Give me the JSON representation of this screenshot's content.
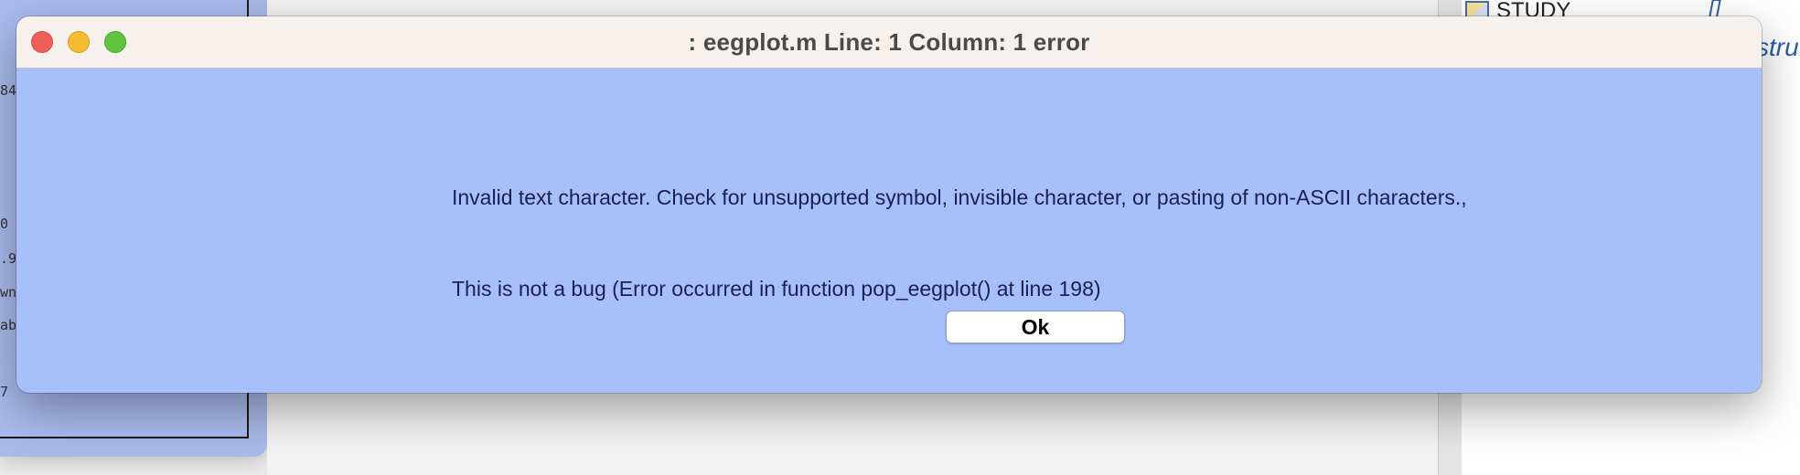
{
  "background": {
    "left_window": {
      "text_lines": [
        "84",
        "0",
        ".9",
        "wn",
        "ab",
        "7"
      ]
    },
    "workspace": {
      "variable_name": "STUDY",
      "variable_value": "[]",
      "variable_class": "stru"
    }
  },
  "dialog": {
    "title": ": eegplot.m Line: 1 Column: 1 error",
    "message_line_1": "Invalid text character. Check for unsupported symbol, invisible character, or pasting of non-ASCII characters.,",
    "message_line_2": "This is not a bug (Error occurred in function pop_eegplot() at line 198)",
    "ok_label": "Ok",
    "colors": {
      "body": "#a7bffa",
      "titlebar": "#f7f1ee",
      "close": "#ee5f57",
      "minimize": "#f5bd2f",
      "maximize": "#5fc43f"
    }
  }
}
